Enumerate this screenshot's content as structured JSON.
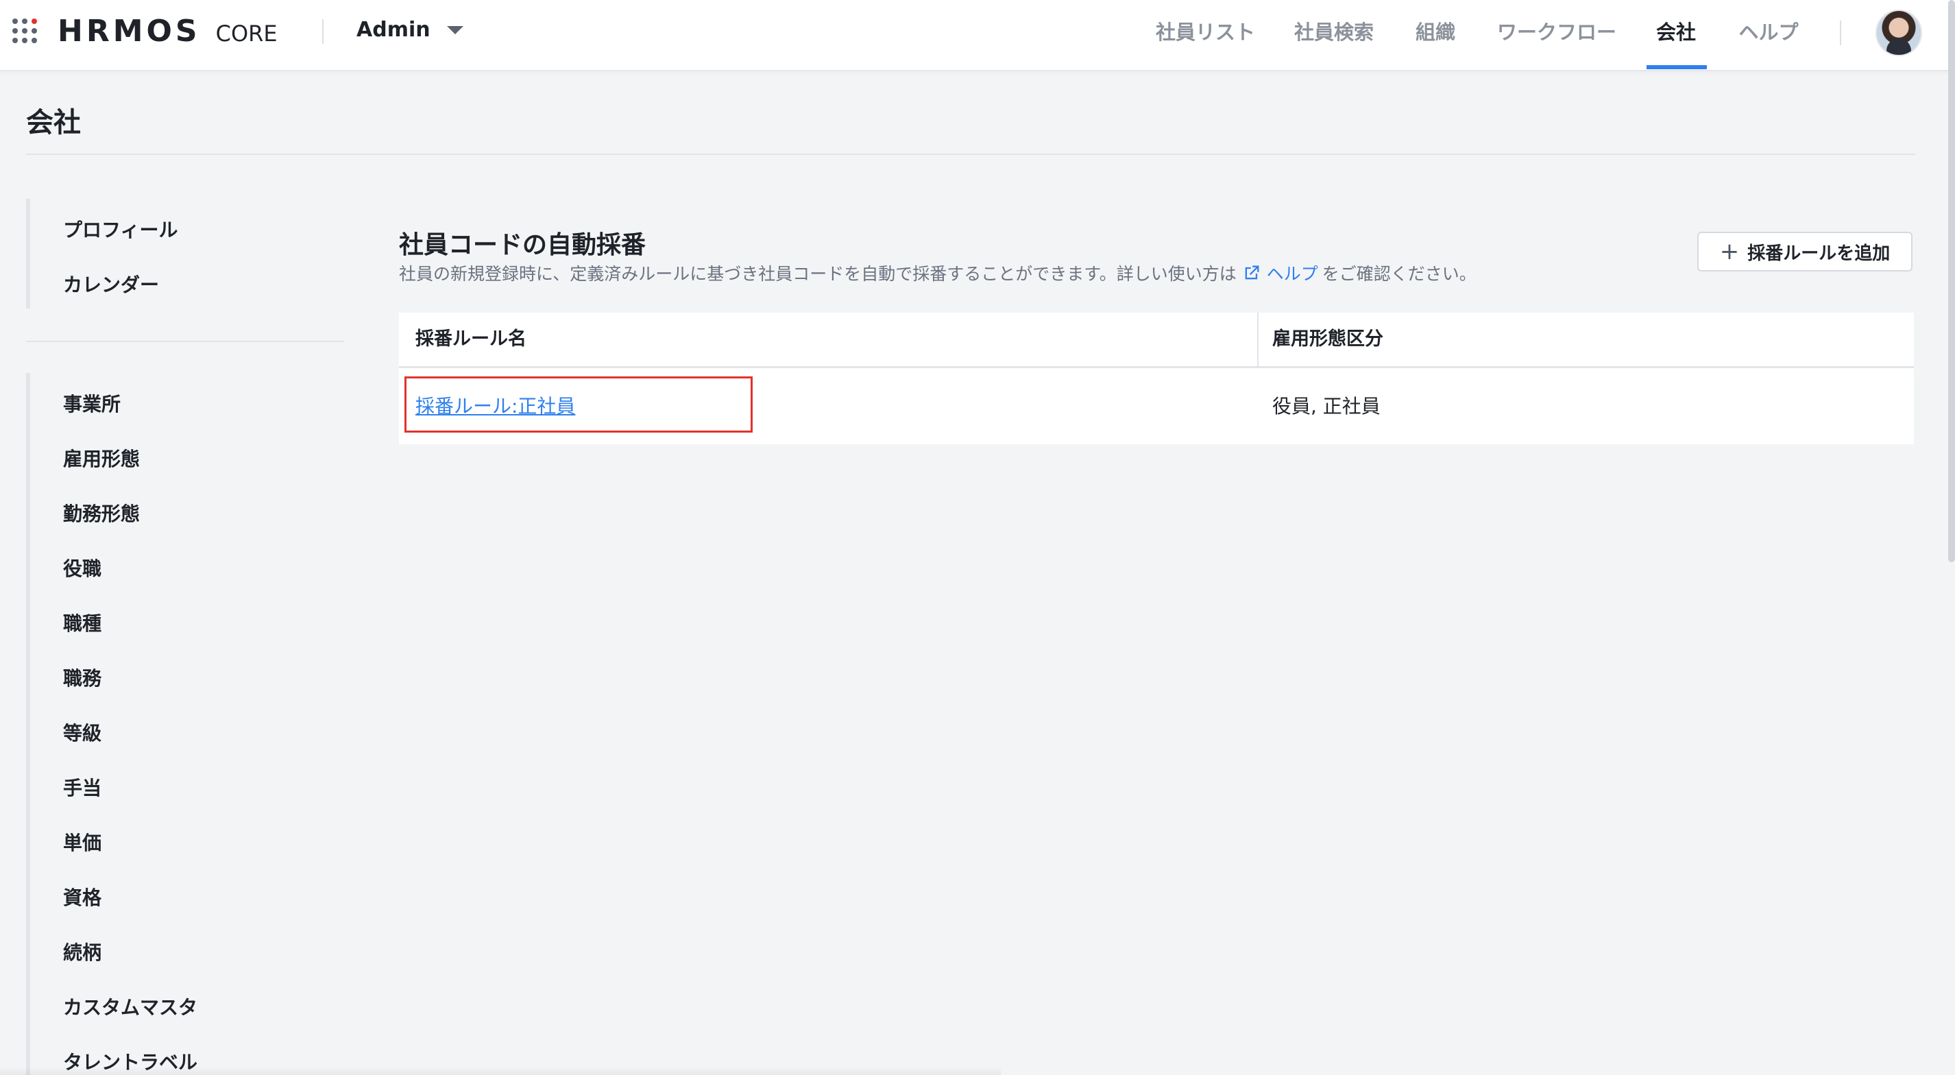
{
  "header": {
    "logo_text": "HRMOS",
    "product_name": "CORE",
    "tenant_label": "Admin",
    "nav": [
      {
        "label": "社員リスト"
      },
      {
        "label": "社員検索"
      },
      {
        "label": "組織"
      },
      {
        "label": "ワークフロー"
      },
      {
        "label": "会社"
      },
      {
        "label": "ヘルプ"
      }
    ],
    "active_nav": "会社"
  },
  "page": {
    "title": "会社"
  },
  "sidebar": {
    "group1": [
      {
        "label": "プロフィール"
      },
      {
        "label": "カレンダー"
      }
    ],
    "group2": [
      {
        "label": "事業所"
      },
      {
        "label": "雇用形態"
      },
      {
        "label": "勤務形態"
      },
      {
        "label": "役職"
      },
      {
        "label": "職種"
      },
      {
        "label": "職務"
      },
      {
        "label": "等級"
      },
      {
        "label": "手当"
      },
      {
        "label": "単価"
      },
      {
        "label": "資格"
      },
      {
        "label": "続柄"
      },
      {
        "label": "カスタムマスタ"
      },
      {
        "label": "タレントラベル"
      }
    ]
  },
  "main": {
    "section_title": "社員コードの自動採番",
    "description_prefix": "社員の新規登録時に、定義済みルールに基づき社員コードを自動で採番することができます。詳しい使い方は",
    "help_link_label": "ヘルプ",
    "description_suffix": "をご確認ください。",
    "add_button_label": "採番ルールを追加",
    "table": {
      "columns": [
        "採番ルール名",
        "雇用形態区分"
      ],
      "rows": [
        {
          "rule_name": "採番ルール:正社員",
          "employment_types": "役員, 正社員"
        }
      ]
    }
  },
  "colors": {
    "accent": "#2f80ed",
    "highlight": "#e2332c",
    "background": "#f3f4f6"
  }
}
